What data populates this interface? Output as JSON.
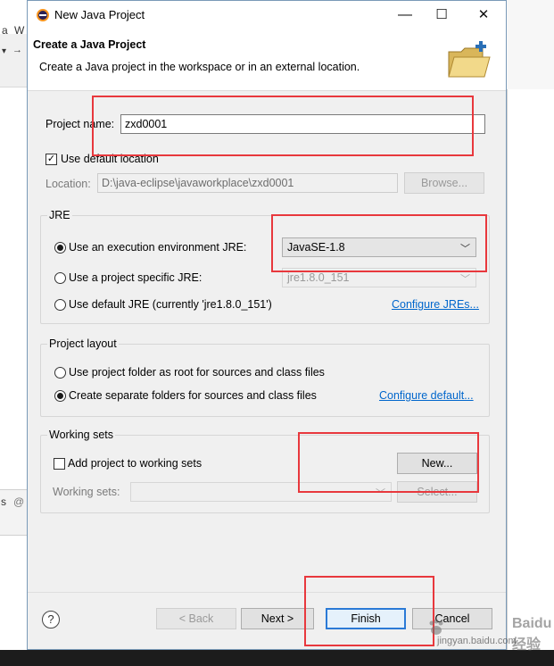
{
  "background": {
    "left_frag_1": "a",
    "left_frag_2": "W",
    "left_frag_3": "s",
    "left_frag_4": "@"
  },
  "window": {
    "title": "New Java Project",
    "minimize": "—",
    "maximize": "☐",
    "close": "✕"
  },
  "header": {
    "title": "Create a Java Project",
    "description": "Create a Java project in the workspace or in an external location."
  },
  "project": {
    "name_label": "Project name:",
    "name_value": "zxd0001",
    "use_default_label": "Use default location",
    "use_default_checked": true,
    "location_label": "Location:",
    "location_value": "D:\\java-eclipse\\javaworkplace\\zxd0001",
    "browse_label": "Browse..."
  },
  "jre": {
    "group_label": "JRE",
    "exec_env_label": "Use an execution environment JRE:",
    "exec_env_value": "JavaSE-1.8",
    "project_specific_label": "Use a project specific JRE:",
    "project_specific_value": "jre1.8.0_151",
    "default_jre_label": "Use default JRE (currently 'jre1.8.0_151')",
    "configure_link": "Configure JREs..."
  },
  "layout": {
    "group_label": "Project layout",
    "root_option": "Use project folder as root for sources and class files",
    "separate_option": "Create separate folders for sources and class files",
    "configure_link": "Configure default..."
  },
  "working_sets": {
    "group_label": "Working sets",
    "add_label": "Add project to working sets",
    "new_label": "New...",
    "sets_label": "Working sets:",
    "select_label": "Select..."
  },
  "footer": {
    "help": "?",
    "back_label": "< Back",
    "next_label": "Next >",
    "finish_label": "Finish",
    "cancel_label": "Cancel"
  },
  "watermark": {
    "brand": "Baidu经验",
    "site": "jingyan.baidu.com"
  },
  "colors": {
    "annotation": "#e8383d",
    "link": "#0066cc",
    "default_button": "#2b7ad6"
  }
}
